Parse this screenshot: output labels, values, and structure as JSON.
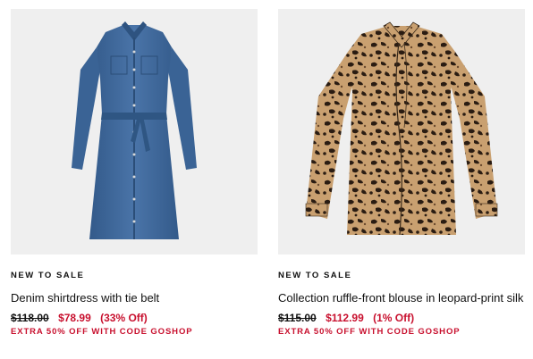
{
  "products": [
    {
      "badge": "NEW TO SALE",
      "title": "Denim shirtdress with tie belt",
      "original_price": "$118.00",
      "sale_price": "$78.99",
      "discount": "(33% Off)",
      "promo": "EXTRA 50% OFF WITH CODE GOSHOP",
      "image_icon": "denim-shirtdress-image"
    },
    {
      "badge": "NEW TO SALE",
      "title": "Collection ruffle-front blouse in leopard-print silk",
      "original_price": "$115.00",
      "sale_price": "$112.99",
      "discount": "(1% Off)",
      "promo": "EXTRA 50% OFF WITH CODE GOSHOP",
      "image_icon": "leopard-blouse-image"
    }
  ],
  "colors": {
    "sale_red": "#c8102e",
    "image_bg": "#efefef",
    "denim": "#3f6798",
    "leopard_base": "#c9a070",
    "leopard_spot": "#2a1c12"
  }
}
